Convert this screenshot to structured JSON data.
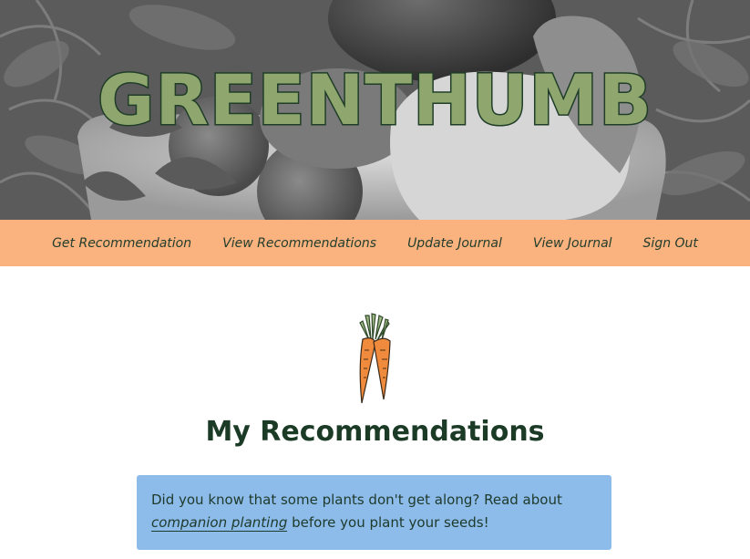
{
  "header": {
    "brand": "GREENTHUMB",
    "hero_image": "grayscale-vegetables-photo"
  },
  "nav": {
    "items": [
      {
        "label": "Get Recommendation"
      },
      {
        "label": "View Recommendations"
      },
      {
        "label": "Update Journal"
      },
      {
        "label": "View Journal"
      },
      {
        "label": "Sign Out"
      }
    ]
  },
  "main": {
    "icon": "carrot-icon",
    "title": "My Recommendations",
    "tip": {
      "text_before": "Did you know that some plants don't get along? Read about ",
      "link_text": "companion planting",
      "text_after": " before you plant your seeds!"
    }
  },
  "colors": {
    "brand_fill": "#8fa76f",
    "brand_stroke": "#1f3d27",
    "nav_bg": "#fab27e",
    "tip_bg": "#8dbbea",
    "title": "#1c3b26",
    "carrot": "#f08a3c"
  }
}
